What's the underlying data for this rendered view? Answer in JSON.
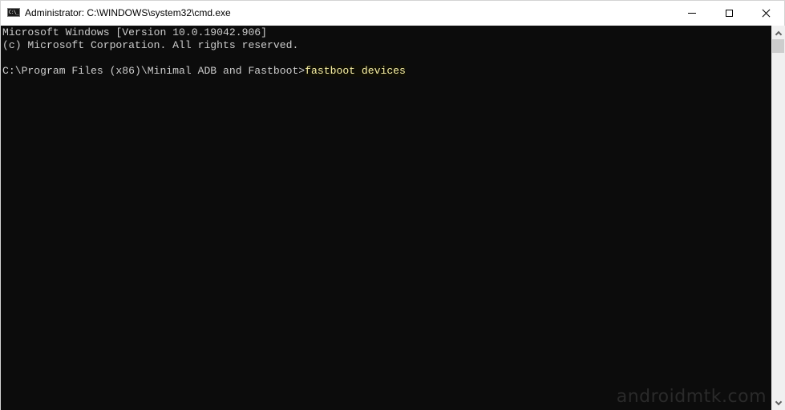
{
  "window": {
    "title": "Administrator: C:\\WINDOWS\\system32\\cmd.exe",
    "app_icon": "cmd-icon",
    "app_icon_text": "C:\\_",
    "controls": {
      "minimize": "minimize-icon",
      "maximize": "maximize-icon",
      "close": "close-icon"
    }
  },
  "console": {
    "lines": [
      "Microsoft Windows [Version 10.0.19042.906]",
      "(c) Microsoft Corporation. All rights reserved.",
      ""
    ],
    "prompt": "C:\\Program Files (x86)\\Minimal ADB and Fastboot>",
    "command": "fastboot devices",
    "colors": {
      "background": "#0c0c0c",
      "text": "#cccccc",
      "command": "#f9f1a5"
    }
  },
  "watermark": "androidmtk.com",
  "scrollbar": {
    "up_icon": "chevron-up-icon",
    "down_icon": "chevron-down-icon"
  }
}
